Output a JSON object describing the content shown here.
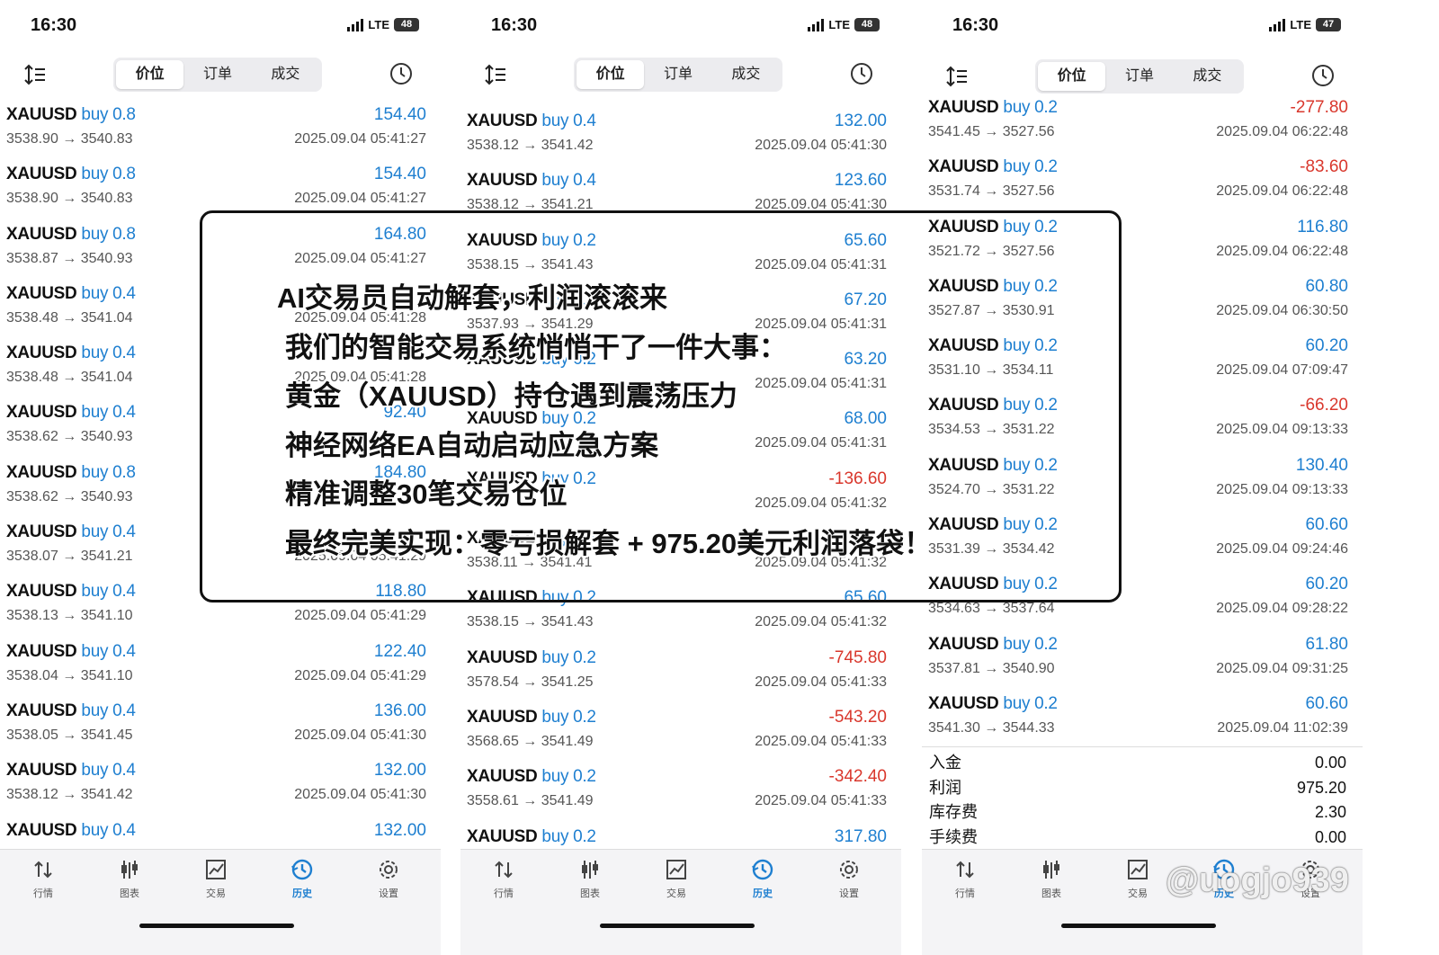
{
  "colors": {
    "positive": "#1e7fd0",
    "negative": "#d9372c",
    "text": "#111111"
  },
  "tabs_segment": [
    "价位",
    "订单",
    "成交"
  ],
  "bottom_tabs": [
    {
      "label": "行情",
      "icon": "updown-arrows-icon"
    },
    {
      "label": "图表",
      "icon": "candlestick-icon"
    },
    {
      "label": "交易",
      "icon": "trade-chart-icon"
    },
    {
      "label": "历史",
      "icon": "history-clock-icon"
    },
    {
      "label": "设置",
      "icon": "gear-icon"
    }
  ],
  "phones": [
    {
      "time": "16:30",
      "network": "LTE",
      "battery": "48",
      "trades": [
        {
          "symbol": "XAUUSD",
          "side": "buy 0.8",
          "profit": "154.40",
          "neg": false,
          "prices": "3538.90 → 3540.83",
          "time": "2025.09.04 05:41:27"
        },
        {
          "symbol": "XAUUSD",
          "side": "buy 0.8",
          "profit": "154.40",
          "neg": false,
          "prices": "3538.90 → 3540.83",
          "time": "2025.09.04 05:41:27"
        },
        {
          "symbol": "XAUUSD",
          "side": "buy 0.8",
          "profit": "164.80",
          "neg": false,
          "prices": "3538.87 → 3540.93",
          "time": "2025.09.04 05:41:27"
        },
        {
          "symbol": "XAUUSD",
          "side": "buy 0.4",
          "profit": "",
          "neg": false,
          "prices": "3538.48 → 3541.04",
          "time": "2025.09.04 05:41:28"
        },
        {
          "symbol": "XAUUSD",
          "side": "buy 0.4",
          "profit": "",
          "neg": false,
          "prices": "3538.48 → 3541.04",
          "time": "2025.09.04 05:41:28"
        },
        {
          "symbol": "XAUUSD",
          "side": "buy 0.4",
          "profit": "92.40",
          "neg": false,
          "prices": "3538.62 → 3540.93",
          "time": ""
        },
        {
          "symbol": "XAUUSD",
          "side": "buy 0.8",
          "profit": "184.80",
          "neg": false,
          "prices": "3538.62 → 3540.93",
          "time": ""
        },
        {
          "symbol": "XAUUSD",
          "side": "buy 0.4",
          "profit": "",
          "neg": false,
          "prices": "3538.07 → 3541.21",
          "time": "2025.09.04 05:41:29"
        },
        {
          "symbol": "XAUUSD",
          "side": "buy 0.4",
          "profit": "118.80",
          "neg": false,
          "prices": "3538.13 → 3541.10",
          "time": "2025.09.04 05:41:29"
        },
        {
          "symbol": "XAUUSD",
          "side": "buy 0.4",
          "profit": "122.40",
          "neg": false,
          "prices": "3538.04 → 3541.10",
          "time": "2025.09.04 05:41:29"
        },
        {
          "symbol": "XAUUSD",
          "side": "buy 0.4",
          "profit": "136.00",
          "neg": false,
          "prices": "3538.05 → 3541.45",
          "time": "2025.09.04 05:41:30"
        },
        {
          "symbol": "XAUUSD",
          "side": "buy 0.4",
          "profit": "132.00",
          "neg": false,
          "prices": "3538.12 → 3541.42",
          "time": "2025.09.04 05:41:30"
        },
        {
          "symbol": "XAUUSD",
          "side": "buy 0.4",
          "profit": "132.00",
          "neg": false,
          "prices": "",
          "time": ""
        }
      ]
    },
    {
      "time": "16:30",
      "network": "LTE",
      "battery": "48",
      "trades": [
        {
          "symbol": "XAUUSD",
          "side": "buy 0.4",
          "profit": "132.00",
          "neg": false,
          "prices": "3538.12 → 3541.42",
          "time": "2025.09.04 05:41:30"
        },
        {
          "symbol": "XAUUSD",
          "side": "buy 0.4",
          "profit": "123.60",
          "neg": false,
          "prices": "3538.12 → 3541.21",
          "time": "2025.09.04 05:41:30"
        },
        {
          "symbol": "XAUUSD",
          "side": "buy 0.2",
          "profit": "65.60",
          "neg": false,
          "prices": "3538.15 → 3541.43",
          "time": "2025.09.04 05:41:31"
        },
        {
          "symbol": "XAUUSD",
          "side": "buy 0.2",
          "profit": "67.20",
          "neg": false,
          "prices": "3537.93 → 3541.29",
          "time": "2025.09.04 05:41:31"
        },
        {
          "symbol": "XAUUSD",
          "side": "buy 0.2",
          "profit": "63.20",
          "neg": false,
          "prices": "",
          "time": "2025.09.04 05:41:31"
        },
        {
          "symbol": "XAUUSD",
          "side": "buy 0.2",
          "profit": "68.00",
          "neg": false,
          "prices": "",
          "time": "2025.09.04 05:41:31"
        },
        {
          "symbol": "XAUUSD",
          "side": "buy 0.2",
          "profit": "-136.60",
          "neg": true,
          "prices": "",
          "time": "2025.09.04 05:41:32"
        },
        {
          "symbol": "XAUUSD",
          "side": "buy 0.2",
          "profit": "",
          "neg": false,
          "prices": "3538.11 → 3541.41",
          "time": "2025.09.04 05:41:32"
        },
        {
          "symbol": "XAUUSD",
          "side": "buy 0.2",
          "profit": "65.60",
          "neg": false,
          "prices": "3538.15 → 3541.43",
          "time": "2025.09.04 05:41:32"
        },
        {
          "symbol": "XAUUSD",
          "side": "buy 0.2",
          "profit": "-745.80",
          "neg": true,
          "prices": "3578.54 → 3541.25",
          "time": "2025.09.04 05:41:33"
        },
        {
          "symbol": "XAUUSD",
          "side": "buy 0.2",
          "profit": "-543.20",
          "neg": true,
          "prices": "3568.65 → 3541.49",
          "time": "2025.09.04 05:41:33"
        },
        {
          "symbol": "XAUUSD",
          "side": "buy 0.2",
          "profit": "-342.40",
          "neg": true,
          "prices": "3558.61 → 3541.49",
          "time": "2025.09.04 05:41:33"
        },
        {
          "symbol": "XAUUSD",
          "side": "buy 0.2",
          "profit": "317.80",
          "neg": false,
          "prices": "",
          "time": ""
        }
      ]
    },
    {
      "time": "16:30",
      "network": "LTE",
      "battery": "47",
      "trades": [
        {
          "symbol": "XAUUSD",
          "side": "buy 0.2",
          "profit": "-277.80",
          "neg": true,
          "prices": "3541.45 → 3527.56",
          "time": "2025.09.04 06:22:48"
        },
        {
          "symbol": "XAUUSD",
          "side": "buy 0.2",
          "profit": "-83.60",
          "neg": true,
          "prices": "3531.74 → 3527.56",
          "time": "2025.09.04 06:22:48"
        },
        {
          "symbol": "XAUUSD",
          "side": "buy 0.2",
          "profit": "116.80",
          "neg": false,
          "prices": "3521.72 → 3527.56",
          "time": "2025.09.04 06:22:48"
        },
        {
          "symbol": "XAUUSD",
          "side": "buy 0.2",
          "profit": "60.80",
          "neg": false,
          "prices": "3527.87 → 3530.91",
          "time": "2025.09.04 06:30:50"
        },
        {
          "symbol": "XAUUSD",
          "side": "buy 0.2",
          "profit": "60.20",
          "neg": false,
          "prices": "3531.10 → 3534.11",
          "time": "2025.09.04 07:09:47"
        },
        {
          "symbol": "XAUUSD",
          "side": "buy 0.2",
          "profit": "-66.20",
          "neg": true,
          "prices": "3534.53 → 3531.22",
          "time": "2025.09.04 09:13:33"
        },
        {
          "symbol": "XAUUSD",
          "side": "buy 0.2",
          "profit": "130.40",
          "neg": false,
          "prices": "3524.70 → 3531.22",
          "time": "2025.09.04 09:13:33"
        },
        {
          "symbol": "XAUUSD",
          "side": "buy 0.2",
          "profit": "60.60",
          "neg": false,
          "prices": "3531.39 → 3534.42",
          "time": "2025.09.04 09:24:46"
        },
        {
          "symbol": "XAUUSD",
          "side": "buy 0.2",
          "profit": "60.20",
          "neg": false,
          "prices": "3534.63 → 3537.64",
          "time": "2025.09.04 09:28:22"
        },
        {
          "symbol": "XAUUSD",
          "side": "buy 0.2",
          "profit": "61.80",
          "neg": false,
          "prices": "3537.81 → 3540.90",
          "time": "2025.09.04 09:31:25"
        },
        {
          "symbol": "XAUUSD",
          "side": "buy 0.2",
          "profit": "60.60",
          "neg": false,
          "prices": "3541.30 → 3544.33",
          "time": "2025.09.04 11:02:39"
        }
      ],
      "summary": [
        {
          "label": "入金",
          "value": "0.00"
        },
        {
          "label": "利润",
          "value": "975.20"
        },
        {
          "label": "库存费",
          "value": "2.30"
        },
        {
          "label": "手续费",
          "value": "0.00"
        }
      ]
    }
  ],
  "overlay_lines": [
    "AI交易员自动解套，利润滚滚来",
    "我们的智能交易系统悄悄干了一件大事：",
    "黄金（XAUUSD）持仓遇到震荡压力",
    "神经网络EA自动启动应急方案",
    "精准调整30笔交易仓位",
    "最终完美实现：零亏损解套 + 975.20美元利润落袋！"
  ],
  "watermark": "@uogjo939"
}
